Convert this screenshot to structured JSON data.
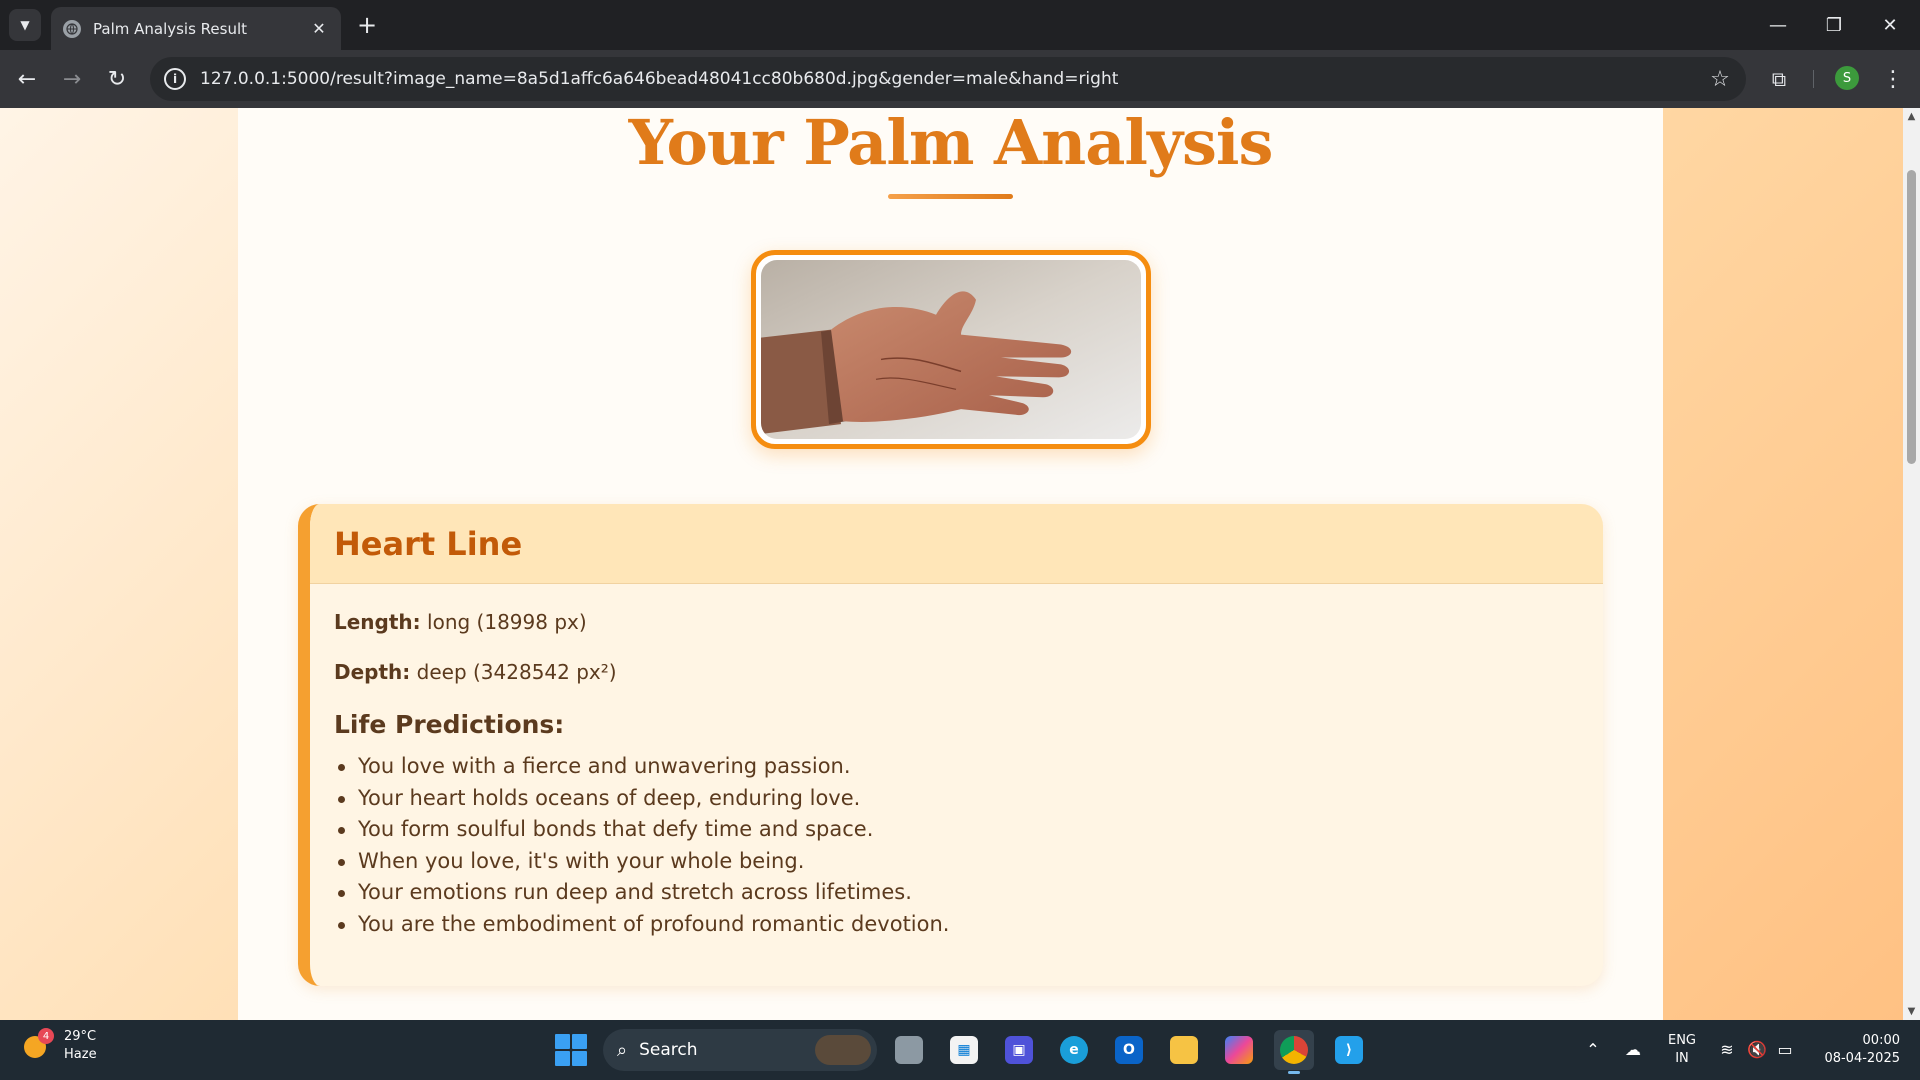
{
  "browser": {
    "tab_title": "Palm Analysis Result",
    "tab_close": "✕",
    "new_tab": "+",
    "url": "127.0.0.1:5000/result?image_name=8a5d1affc6a646bead48041cc80b680d.jpg&gender=male&hand=right",
    "profile_initial": "S"
  },
  "page": {
    "title": "Your Palm Analysis",
    "card": {
      "title": "Heart Line",
      "length_label": "Length:",
      "length_value": " long (18998 px)",
      "depth_label": "Depth:",
      "depth_value": " deep (3428542 px²)",
      "predictions_heading": "Life Predictions:",
      "predictions": [
        "You love with a fierce and unwavering passion.",
        "Your heart holds oceans of deep, enduring love.",
        "You form soulful bonds that defy time and space.",
        "When you love, it's with your whole being.",
        "Your emotions run deep and stretch across lifetimes.",
        "You are the embodiment of profound romantic devotion."
      ]
    },
    "accent_color": "#e07b1a",
    "card_border_color": "#f5a030"
  },
  "taskbar": {
    "weather_badge": "4",
    "temperature": "29°C",
    "condition": "Haze",
    "search_label": "Search",
    "lang_line1": "ENG",
    "lang_line2": "IN",
    "time": "00:00",
    "date": "08-04-2025"
  }
}
